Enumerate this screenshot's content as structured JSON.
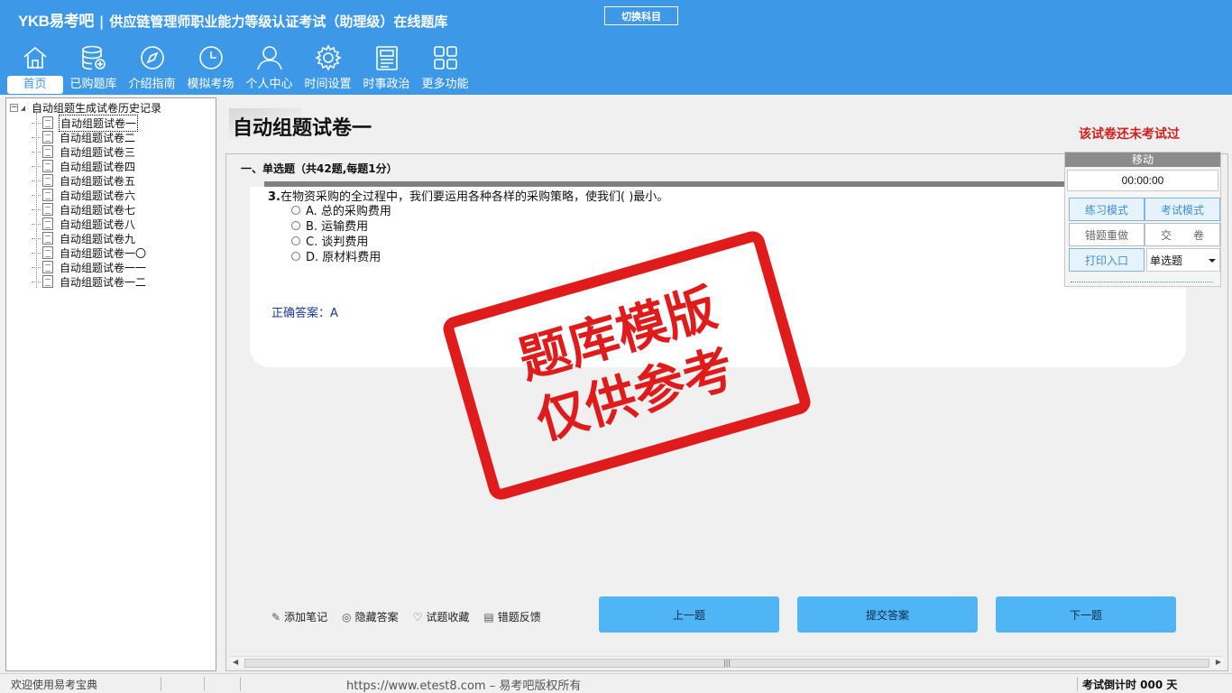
{
  "header": {
    "logo": "YKB易考吧",
    "title": "供应链管理师职业能力等级认证考试（助理级）在线题库",
    "switch_label": "切换科目"
  },
  "nav": [
    {
      "label": "首页",
      "icon": "home-icon"
    },
    {
      "label": "已购题库",
      "icon": "database-icon"
    },
    {
      "label": "介绍指南",
      "icon": "compass-icon"
    },
    {
      "label": "模拟考场",
      "icon": "clock-icon"
    },
    {
      "label": "个人中心",
      "icon": "user-icon"
    },
    {
      "label": "时间设置",
      "icon": "gear-icon"
    },
    {
      "label": "时事政治",
      "icon": "news-icon"
    },
    {
      "label": "更多功能",
      "icon": "grid-icon"
    }
  ],
  "tree": {
    "root": "自动组题生成试卷历史记录",
    "items": [
      "自动组题试卷一",
      "自动组题试卷二",
      "自动组题试卷三",
      "自动组题试卷四",
      "自动组题试卷五",
      "自动组题试卷六",
      "自动组题试卷七",
      "自动组题试卷八",
      "自动组题试卷九",
      "自动组题试卷一〇",
      "自动组题试卷一一",
      "自动组题试卷一二"
    ]
  },
  "main": {
    "title": "自动组题试卷一",
    "status": "该试卷还未考试过",
    "section": "一、单选题（共42题,每题1分）",
    "question_num": "3.",
    "question": "在物资采购的全过程中，我们要运用各种各样的采购策略，使我们(  )最小。",
    "options": [
      "A. 总的采购费用",
      "B. 运输费用",
      "C. 谈判费用",
      "D. 原材料费用"
    ],
    "answer": "正确答案：A"
  },
  "tools": [
    {
      "label": "添加笔记",
      "icon": "pencil-icon"
    },
    {
      "label": "隐藏答案",
      "icon": "eye-icon"
    },
    {
      "label": "试题收藏",
      "icon": "heart-icon"
    },
    {
      "label": "错题反馈",
      "icon": "feedback-icon"
    }
  ],
  "buttons": {
    "prev": "上一题",
    "submit": "提交答案",
    "next": "下一题"
  },
  "panel": {
    "move": "移动",
    "timer": "00:00:00",
    "practice": "练习模式",
    "exam": "考试模式",
    "redo": "错题重做",
    "hand_in": "交　　卷",
    "print": "打印入口",
    "type_select": "单选题"
  },
  "stamp": {
    "line1": "题库模版",
    "line2": "仅供参考"
  },
  "statusbar": {
    "welcome": "欢迎使用易考宝典",
    "copyright": "https://www.etest8.com – 易考吧版权所有",
    "countdown": "考试倒计时 000 天"
  },
  "colors": {
    "brand": "#3d98e8",
    "button": "#4fb5f5",
    "status_red": "#d41d1d",
    "stamp": "#e01b1b"
  }
}
